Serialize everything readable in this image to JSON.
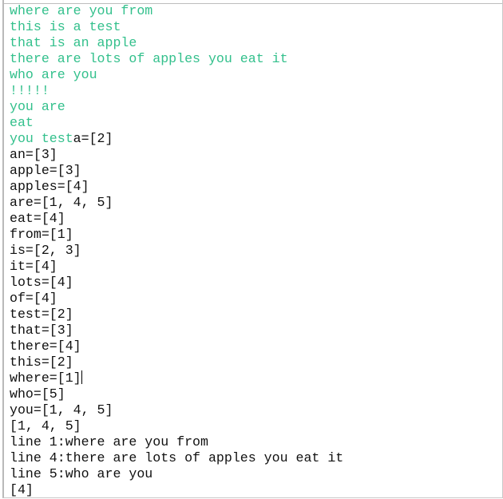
{
  "console": {
    "input_color": "#33c08c",
    "output_color": "#111111",
    "input_lines": [
      "where are you from",
      "this is a test",
      "that is an apple",
      "there are lots of apples you eat it",
      "who are you",
      "!!!!!",
      "you are",
      "eat",
      "you test"
    ],
    "first_output_inline": "a=[2]",
    "output_lines": [
      "an=[3]",
      "apple=[3]",
      "apples=[4]",
      "are=[1, 4, 5]",
      "eat=[4]",
      "from=[1]",
      "is=[2, 3]",
      "it=[4]",
      "lots=[4]",
      "of=[4]",
      "test=[2]",
      "that=[3]",
      "there=[4]",
      "this=[2]",
      "where=[1]",
      "who=[5]",
      "you=[1, 4, 5]",
      "[1, 4, 5]",
      "line 1:where are you from",
      "line 4:there are lots of apples you eat it",
      "line 5:who are you",
      "[4]"
    ],
    "cursor_after_line": 14
  }
}
